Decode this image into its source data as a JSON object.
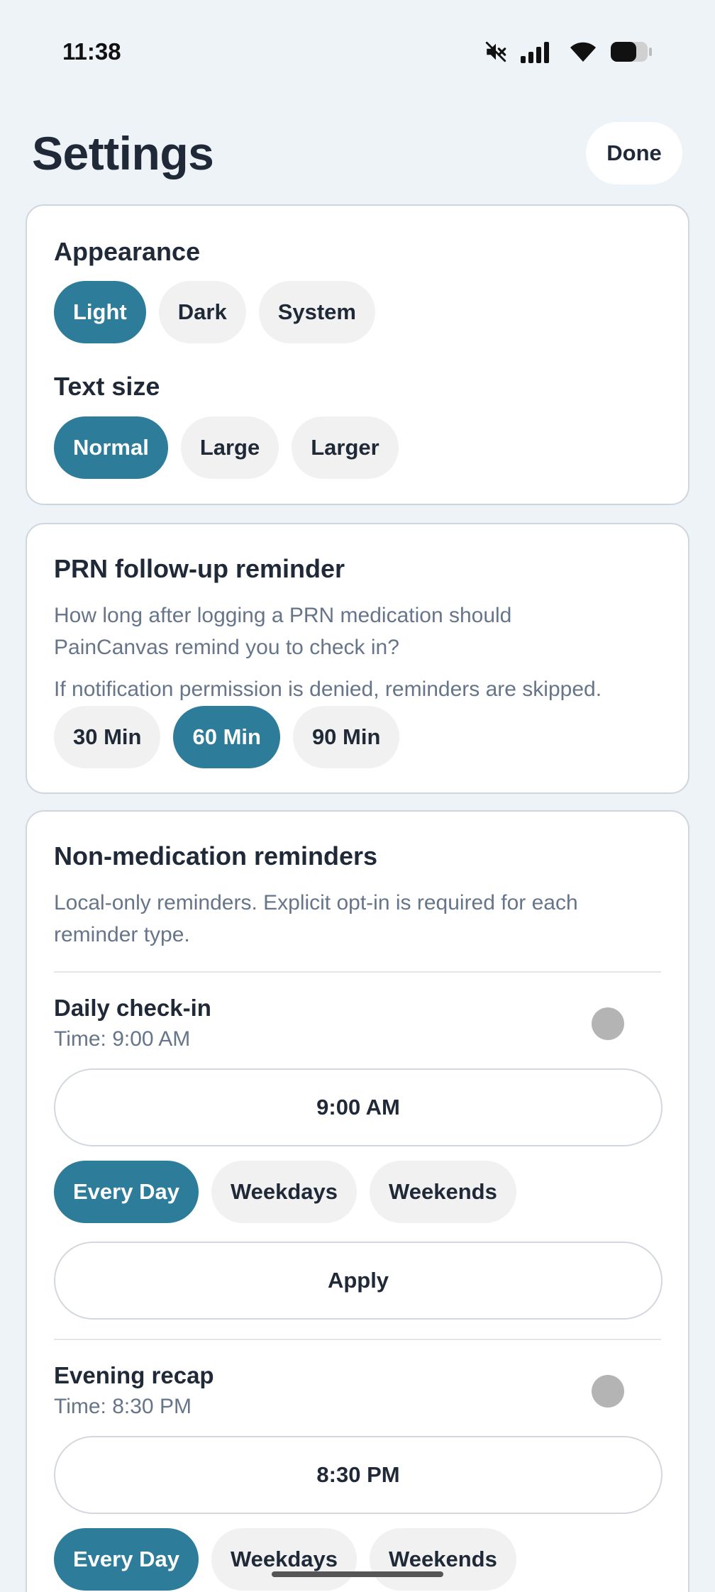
{
  "status": {
    "time": "11:38"
  },
  "header": {
    "title": "Settings",
    "done_label": "Done"
  },
  "appearance": {
    "title": "Appearance",
    "options": [
      "Light",
      "Dark",
      "System"
    ],
    "selected": "Light"
  },
  "text_size": {
    "title": "Text size",
    "options": [
      "Normal",
      "Large",
      "Larger"
    ],
    "selected": "Normal"
  },
  "prn": {
    "title": "PRN follow-up reminder",
    "description": "How long after logging a PRN medication should PainCanvas remind you to check in?",
    "note": "If notification permission is denied, reminders are skipped.",
    "options": [
      "30 Min",
      "60 Min",
      "90 Min"
    ],
    "selected": "60 Min"
  },
  "non_med": {
    "title": "Non-medication reminders",
    "description": "Local-only reminders. Explicit opt-in is required for each reminder type.",
    "reminders": [
      {
        "title": "Daily check-in",
        "time_label": "Time: 9:00 AM",
        "time_button": "9:00 AM",
        "enabled": false,
        "frequency_options": [
          "Every Day",
          "Weekdays",
          "Weekends"
        ],
        "frequency_selected": "Every Day",
        "apply_label": "Apply"
      },
      {
        "title": "Evening recap",
        "time_label": "Time: 8:30 PM",
        "time_button": "8:30 PM",
        "enabled": false,
        "frequency_options": [
          "Every Day",
          "Weekdays",
          "Weekends"
        ],
        "frequency_selected": "Every Day"
      }
    ]
  },
  "colors": {
    "accent": "#2d7c99",
    "background": "#eef3f8",
    "pill": "#f1f1f1"
  }
}
